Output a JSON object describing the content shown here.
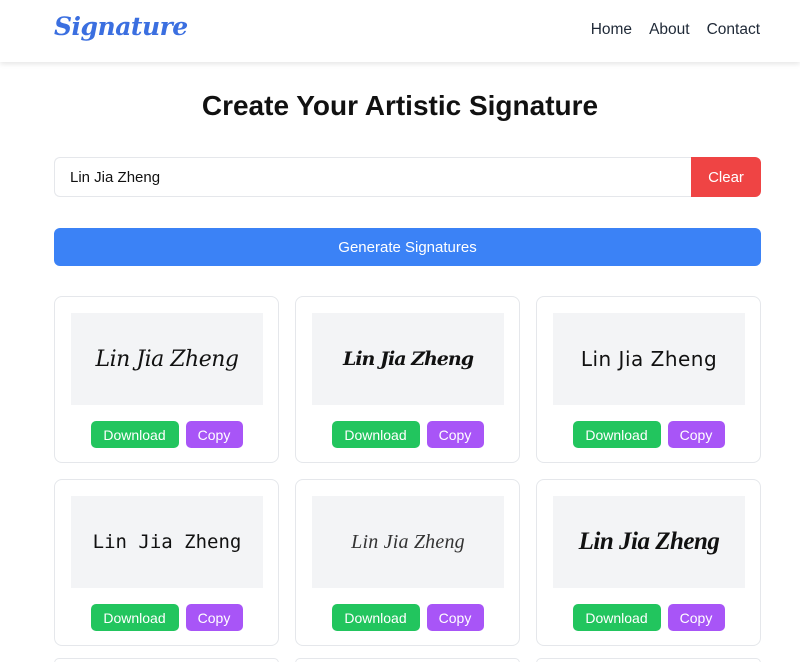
{
  "colors": {
    "brand": "#3b6fe0",
    "primary": "#3b82f6",
    "danger": "#ef4444",
    "download": "#22c55e",
    "copy": "#a855f7"
  },
  "header": {
    "logo": "Signature",
    "nav": [
      {
        "label": "Home"
      },
      {
        "label": "About"
      },
      {
        "label": "Contact"
      }
    ]
  },
  "main": {
    "title": "Create Your Artistic Signature",
    "input_value": "Lin Jia Zheng",
    "clear_label": "Clear",
    "generate_label": "Generate Signatures",
    "cards": [
      {
        "text": "Lin Jia Zheng",
        "download_label": "Download",
        "copy_label": "Copy"
      },
      {
        "text": "Lin Jia Zheng",
        "download_label": "Download",
        "copy_label": "Copy"
      },
      {
        "text": "Lin Jia Zheng",
        "download_label": "Download",
        "copy_label": "Copy"
      },
      {
        "text": "Lin Jia Zheng",
        "download_label": "Download",
        "copy_label": "Copy"
      },
      {
        "text": "Lin Jia Zheng",
        "download_label": "Download",
        "copy_label": "Copy"
      },
      {
        "text": "Lin Jia Zheng",
        "download_label": "Download",
        "copy_label": "Copy"
      }
    ]
  }
}
